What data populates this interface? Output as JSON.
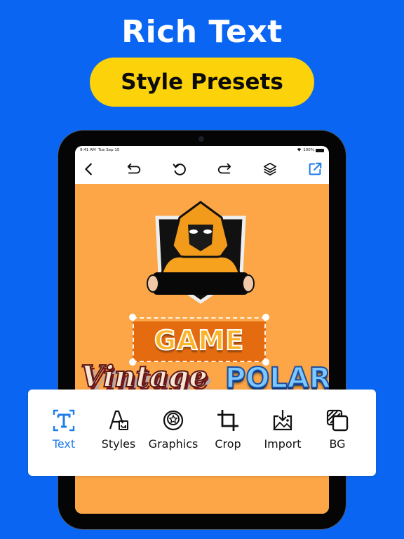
{
  "promo": {
    "headline": "Rich Text",
    "badge": "Style Presets"
  },
  "colors": {
    "background": "#0a66f2",
    "badge": "#fcd30a",
    "accent": "#1f7cea",
    "canvas": "#fca647"
  },
  "status_bar": {
    "time": "9:41 AM",
    "date": "Tue Sep 15",
    "battery": "100%"
  },
  "toolbar": {
    "buttons": [
      {
        "name": "back",
        "icon": "chevron-left-icon"
      },
      {
        "name": "undo",
        "icon": "undo-icon"
      },
      {
        "name": "rotate",
        "icon": "rotate-icon"
      },
      {
        "name": "redo",
        "icon": "redo-icon"
      },
      {
        "name": "layers",
        "icon": "layers-icon"
      },
      {
        "name": "export",
        "icon": "export-icon"
      }
    ]
  },
  "canvas": {
    "logo": "hooded-gamer-mascot",
    "text_layers": [
      {
        "text": "GAME",
        "style": "3d-orange",
        "selected": true
      },
      {
        "text": "Vintage",
        "style": "retro-script"
      },
      {
        "text": "POLAR",
        "style": "ice-blue"
      }
    ]
  },
  "tools": [
    {
      "label": "Text",
      "icon": "text-icon",
      "active": true
    },
    {
      "label": "Styles",
      "icon": "styles-icon",
      "active": false
    },
    {
      "label": "Graphics",
      "icon": "graphics-icon",
      "active": false
    },
    {
      "label": "Crop",
      "icon": "crop-icon",
      "active": false
    },
    {
      "label": "Import",
      "icon": "import-icon",
      "active": false
    },
    {
      "label": "BG",
      "icon": "background-icon",
      "active": false
    }
  ]
}
